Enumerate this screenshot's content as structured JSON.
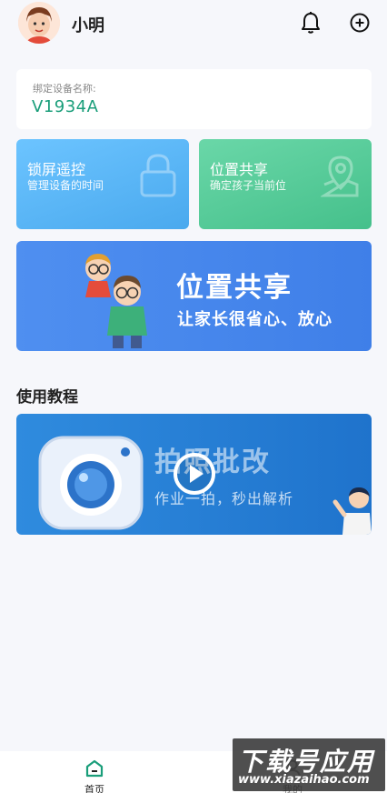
{
  "header": {
    "username": "小明"
  },
  "device": {
    "label": "绑定设备名称:",
    "value": "V1934A"
  },
  "features": [
    {
      "title": "锁屏遥控",
      "subtitle": "管理设备的时间",
      "icon": "lock-icon"
    },
    {
      "title": "位置共享",
      "subtitle": "确定孩子当前位",
      "icon": "map-pin-icon"
    }
  ],
  "banner": {
    "title": "位置共享",
    "subtitle": "让家长很省心、放心"
  },
  "tutorial": {
    "section_title": "使用教程",
    "video_title": "拍照批改",
    "video_subtitle": "作业一拍，秒出解析"
  },
  "nav": {
    "home_label": "首页",
    "mine_label": "我的"
  },
  "watermark": {
    "line1": "下载号应用",
    "line2": "www.xiazaihao.com"
  },
  "colors": {
    "accent_green": "#1a9e7a",
    "lock_card": "#5bb8f9",
    "location_card": "#55cb97",
    "banner_blue": "#4a8aee"
  }
}
